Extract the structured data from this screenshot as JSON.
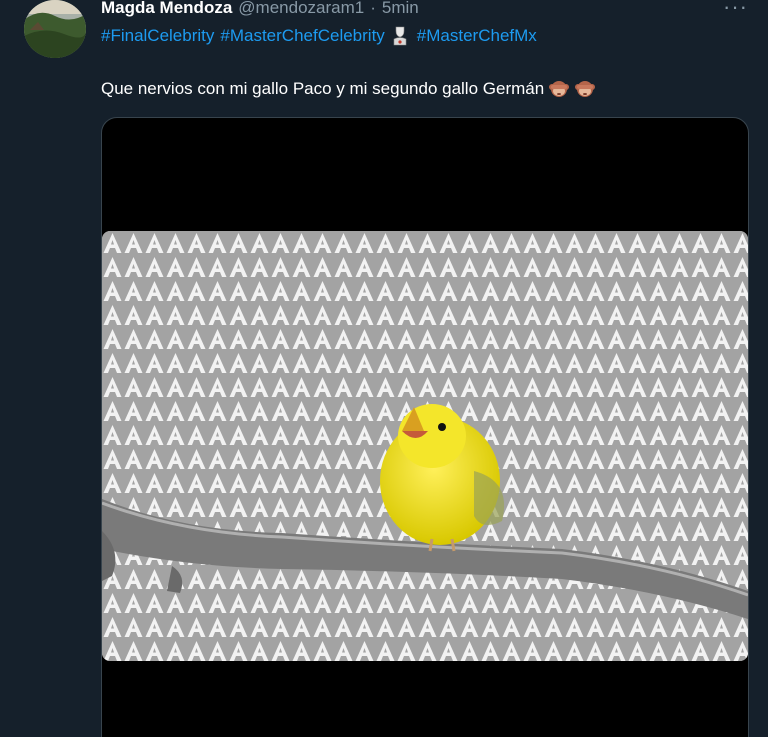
{
  "user": {
    "display_name": "Magda Mendoza",
    "handle": "@mendozaram1",
    "separator": "·",
    "time": "5min"
  },
  "more_label": "···",
  "hashtags": [
    "#FinalCelebrity",
    "#MasterChefCelebrity",
    "#MasterChefMx"
  ],
  "tweet_text": "Que nervios con mi gallo Paco y mi segundo gallo Germán",
  "emojis": [
    "see-no-evil-monkey-icon",
    "see-no-evil-monkey-icon"
  ],
  "media": {
    "pattern_letter": "A",
    "subject": "yellow-canary-on-branch"
  },
  "colors": {
    "background": "#15202b",
    "link": "#1d9bf0",
    "muted": "#8899a6",
    "text": "#ffffff"
  }
}
